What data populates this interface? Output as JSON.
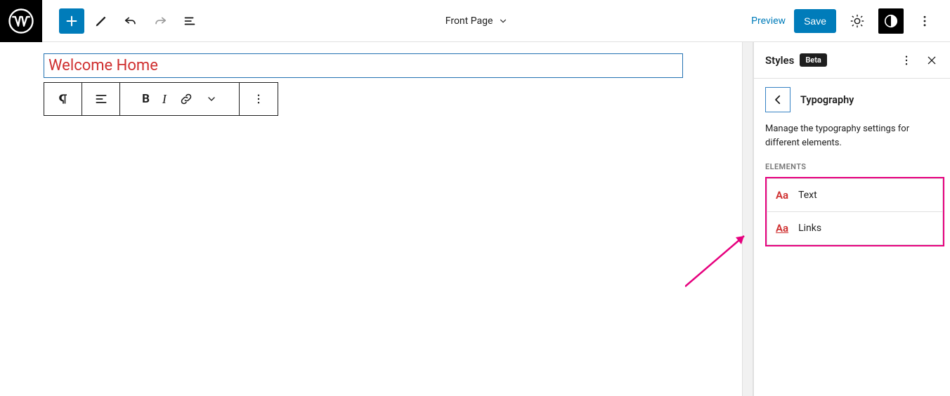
{
  "topbar": {
    "template_label": "Front Page",
    "preview": "Preview",
    "save": "Save"
  },
  "editor": {
    "heading_text": "Welcome Home"
  },
  "sidebar": {
    "title": "Styles",
    "badge": "Beta",
    "section_title": "Typography",
    "description": "Manage the typography settings for different elements.",
    "elements_label": "ELEMENTS",
    "items": [
      {
        "icon": "Aa",
        "label": "Text",
        "underline": false
      },
      {
        "icon": "Aa",
        "label": "Links",
        "underline": true
      }
    ]
  }
}
